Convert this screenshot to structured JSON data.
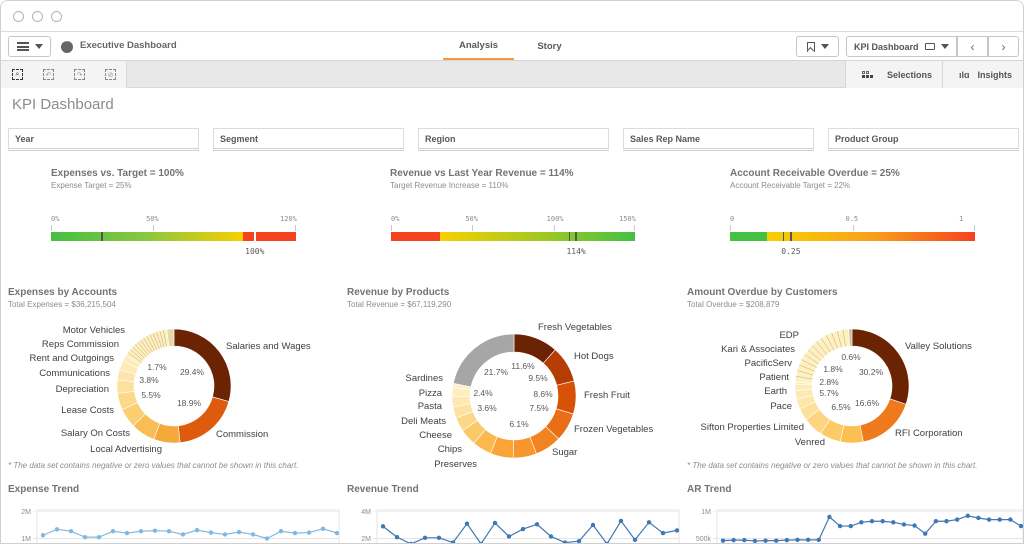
{
  "titlebar": {
    "buttons": [
      "close",
      "minimize",
      "maximize"
    ]
  },
  "appbar": {
    "app_title": "Executive Dashboard",
    "tabs": [
      {
        "label": "Analysis",
        "active": true
      },
      {
        "label": "Story",
        "active": false
      }
    ],
    "sheet_name": "KPI Dashboard",
    "prev_label": "‹",
    "next_label": "›"
  },
  "toolbar": {
    "selections_label": "Selections",
    "insights_label": "Insights"
  },
  "page_title": "KPI Dashboard",
  "filters": [
    "Year",
    "Segment",
    "Region",
    "Sales Rep Name",
    "Product Group"
  ],
  "kpis": [
    {
      "title": "Expenses vs. Target = 100%",
      "subtitle": "Expense Target = 25%",
      "ticks": [
        "0%",
        "50%",
        "120%"
      ],
      "range": [
        0,
        1.2
      ],
      "value_label": "100%",
      "value": 1.0,
      "target": 0.25,
      "segments": [
        {
          "from": 0,
          "to": 0.94,
          "colors": [
            "#44c044",
            "#8cc63f",
            "#f7d000"
          ]
        },
        {
          "from": 0.94,
          "to": 1.2,
          "colors": [
            "#f5421f",
            "#f5421f"
          ]
        }
      ]
    },
    {
      "title": "Revenue vs Last Year Revenue = 114%",
      "subtitle": "Target Revenue Increase = 110%",
      "ticks": [
        "0%",
        "50%",
        "100%",
        "150%"
      ],
      "range": [
        0,
        1.5
      ],
      "value_label": "114%",
      "value": 1.14,
      "target": 1.1,
      "segments": [
        {
          "from": 0,
          "to": 0.3,
          "colors": [
            "#f5421f",
            "#f5421f"
          ]
        },
        {
          "from": 0.3,
          "to": 1.5,
          "colors": [
            "#f7d000",
            "#a6c822",
            "#44c044"
          ]
        }
      ]
    },
    {
      "title": "Account Receivable Overdue = 25%",
      "subtitle": "Account Receivable Target = 22%",
      "ticks": [
        "0",
        "0.5",
        "1"
      ],
      "range": [
        0,
        1
      ],
      "value_label": "0.25",
      "value": 0.25,
      "target": 0.22,
      "segments": [
        {
          "from": 0,
          "to": 0.15,
          "colors": [
            "#44c044",
            "#44c044"
          ]
        },
        {
          "from": 0.15,
          "to": 1,
          "colors": [
            "#f7d000",
            "#f8a11c",
            "#f5421f"
          ]
        }
      ]
    }
  ],
  "donuts": [
    {
      "title": "Expenses by Accounts",
      "subtitle": "Total Expenses = $36,215,504",
      "footnote": "* The data set contains negative or zero values that cannot be shown in this chart.",
      "slices": [
        {
          "label": "Salaries and Wages",
          "value": 29.4,
          "color": "#6b2403",
          "pct": "29.4%"
        },
        {
          "label": "Commission",
          "value": 18.9,
          "color": "#de5a0c",
          "pct": "18.9%"
        },
        {
          "label": "Local Advertising",
          "value": 7.5,
          "color": "#f6a93b"
        },
        {
          "label": "Salary On Costs",
          "value": 6.9,
          "color": "#f9bd55"
        },
        {
          "label": "Lease Costs",
          "value": 5.5,
          "color": "#fbce72",
          "pct": "5.5%"
        },
        {
          "label": "Depreciation",
          "value": 4.7,
          "color": "#fcd98a"
        },
        {
          "label": "Communications",
          "value": 3.8,
          "color": "#fde09c",
          "pct": "3.8%"
        },
        {
          "label": "Rent and Outgoings",
          "value": 3.0,
          "color": "#fde6ab"
        },
        {
          "label": "Reps Commission",
          "value": 2.6,
          "color": "#feeab4"
        },
        {
          "label": "Motor Vehicles",
          "value": 1.7,
          "color": "#feecb9",
          "pct": "1.7%"
        },
        {
          "label": "",
          "value": 14.0,
          "color": "#ffefc0",
          "striped": true
        },
        {
          "label": "",
          "value": 2.0,
          "color": "#e4d8a6"
        }
      ]
    },
    {
      "title": "Revenue by Products",
      "subtitle": "Total Revenue = $67,119,290",
      "slices": [
        {
          "label": "Fresh Vegetables",
          "value": 11.6,
          "color": "#6b2403",
          "pct": "11.6%"
        },
        {
          "label": "Hot Dogs",
          "value": 9.5,
          "color": "#b53c04",
          "pct": "9.5%"
        },
        {
          "label": "Fresh Fruit",
          "value": 8.6,
          "color": "#d85109",
          "pct": "8.6%"
        },
        {
          "label": "Frozen Vegetables",
          "value": 7.5,
          "color": "#ea6e17",
          "pct": "7.5%"
        },
        {
          "label": "Sugar",
          "value": 6.9,
          "color": "#f28322"
        },
        {
          "label": "",
          "value": 6.1,
          "color": "#f6962d",
          "pct": "6.1%"
        },
        {
          "label": "",
          "value": 6.0,
          "color": "#f8a436"
        },
        {
          "label": "Preserves",
          "value": 5.0,
          "color": "#fab94f"
        },
        {
          "label": "Chips",
          "value": 4.4,
          "color": "#fcc969"
        },
        {
          "label": "Cheese",
          "value": 3.6,
          "color": "#fcd788",
          "pct": "3.6%"
        },
        {
          "label": "Deli Meats",
          "value": 3.0,
          "color": "#fde19e"
        },
        {
          "label": "Pasta",
          "value": 2.6,
          "color": "#fee8b0"
        },
        {
          "label": "Pizza",
          "value": 2.4,
          "color": "#feedbd",
          "pct": "2.4%"
        },
        {
          "label": "Sardines",
          "value": 1.1,
          "color": "#fff1c8"
        },
        {
          "label": "",
          "value": 21.7,
          "color": "#a6a6a6",
          "pct": "21.7%"
        }
      ]
    },
    {
      "title": "Amount Overdue by Customers",
      "subtitle": "Total Overdue = $208,879",
      "footnote": "* The data set contains negative or zero values that cannot be shown in this chart.",
      "slices": [
        {
          "label": "Valley  Solutions",
          "value": 30.2,
          "color": "#6b2403",
          "pct": "30.2%"
        },
        {
          "label": "RFI Corporation",
          "value": 16.6,
          "color": "#ee7a1c",
          "pct": "16.6%"
        },
        {
          "label": "Venred",
          "value": 6.5,
          "color": "#fbc04f",
          "pct": "6.5%"
        },
        {
          "label": "Sifton Properties Limited",
          "value": 6.0,
          "color": "#fccb66"
        },
        {
          "label": "Pace",
          "value": 5.7,
          "color": "#fdd581",
          "pct": "5.7%"
        },
        {
          "label": "Earth",
          "value": 3.5,
          "color": "#fde099"
        },
        {
          "label": "Patient",
          "value": 2.8,
          "color": "#fee5a8",
          "pct": "2.8%"
        },
        {
          "label": "PacificServ",
          "value": 2.4,
          "color": "#fee9b2"
        },
        {
          "label": "Kari & Associates",
          "value": 1.8,
          "color": "#feebb7",
          "pct": "1.8%"
        },
        {
          "label": "EDP",
          "value": 0.6,
          "color": "#feedbc",
          "pct": "0.6%"
        },
        {
          "label": "",
          "value": 23.0,
          "color": "#fff0c2",
          "striped": true
        },
        {
          "label": "",
          "value": 0.9,
          "color": "#c8bd95"
        }
      ]
    }
  ],
  "trends": [
    {
      "title": "Expense Trend",
      "yticks": [
        "2M",
        "1M"
      ],
      "ylim": [
        0.9,
        2.1
      ],
      "color": "#7fb9e1",
      "values": [
        1.12,
        1.34,
        1.27,
        1.05,
        1.05,
        1.27,
        1.2,
        1.27,
        1.29,
        1.27,
        1.15,
        1.31,
        1.22,
        1.15,
        1.24,
        1.15,
        1.0,
        1.27,
        1.2,
        1.22,
        1.36,
        1.2
      ]
    },
    {
      "title": "Revenue Trend",
      "yticks": [
        "4M",
        "2M"
      ],
      "ylim": [
        1.5,
        4.3
      ],
      "color": "#3f78b4",
      "values": [
        2.9,
        2.1,
        1.6,
        2.05,
        2.05,
        1.7,
        3.1,
        1.6,
        3.15,
        2.15,
        2.7,
        3.05,
        2.15,
        1.7,
        1.8,
        3.0,
        1.6,
        3.3,
        1.9,
        3.2,
        2.4,
        2.6
      ]
    },
    {
      "title": "AR Trend",
      "yticks": [
        "1M",
        "500k"
      ],
      "ylim": [
        420,
        1050
      ],
      "color": "#3f78b4",
      "values": [
        460,
        470,
        470,
        455,
        460,
        460,
        470,
        475,
        475,
        475,
        900,
        730,
        730,
        800,
        820,
        820,
        800,
        760,
        740,
        590,
        820,
        820,
        850,
        920,
        880,
        850,
        850,
        850,
        730
      ]
    }
  ]
}
